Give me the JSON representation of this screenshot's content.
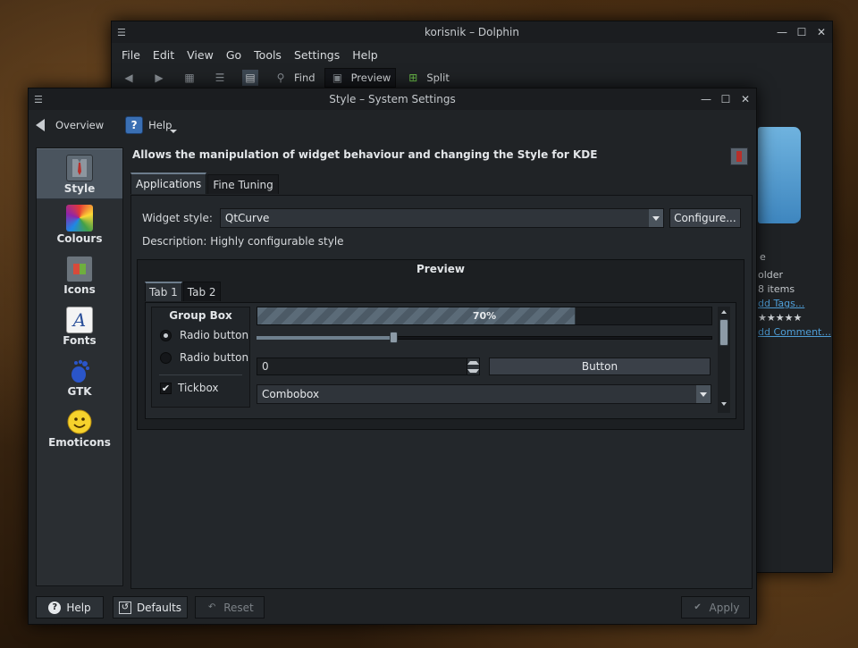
{
  "dolphin": {
    "title": "korisnik – Dolphin",
    "menu": [
      "File",
      "Edit",
      "View",
      "Go",
      "Tools",
      "Settings",
      "Help"
    ],
    "toolbar": {
      "find": "Find",
      "preview": "Preview",
      "split": "Split"
    },
    "info": {
      "line1": "e",
      "line2": "older",
      "line3": "8 items",
      "add_tags": "dd Tags...",
      "stars": "★★★★★",
      "add_comment": "dd Comment..."
    }
  },
  "style_window": {
    "title": "Style – System Settings",
    "toolbar": {
      "overview": "Overview",
      "help": "Help"
    },
    "sidebar": {
      "items": [
        {
          "label": "Style",
          "icon": "style-tie-icon",
          "active": true
        },
        {
          "label": "Colours",
          "icon": "colour-palette-icon",
          "active": false
        },
        {
          "label": "Icons",
          "icon": "icons-cube-icon",
          "active": false
        },
        {
          "label": "Fonts",
          "icon": "font-letter-icon",
          "active": false
        },
        {
          "label": "GTK",
          "icon": "gtk-gnome-foot-icon",
          "active": false
        },
        {
          "label": "Emoticons",
          "icon": "smiley-icon",
          "active": false
        }
      ]
    },
    "heading": "Allows the manipulation of widget behaviour and changing the Style for KDE",
    "tabs": [
      "Applications",
      "Fine Tuning"
    ],
    "widget_style_label": "Widget style:",
    "widget_style_value": "QtCurve",
    "configure_label": "Configure...",
    "description": "Description: Highly configurable style",
    "preview": {
      "title": "Preview",
      "tabs": [
        "Tab 1",
        "Tab 2"
      ],
      "group_box": "Group Box",
      "radio1": "Radio button",
      "radio2": "Radio button",
      "tickbox": "Tickbox",
      "progress_text": "70%",
      "progress_value": 0.7,
      "slider_value": 0.3,
      "spin_value": "0",
      "button_label": "Button",
      "combo_value": "Combobox"
    },
    "buttons": {
      "help": "Help",
      "defaults": "Defaults",
      "reset": "Reset",
      "apply": "Apply"
    }
  },
  "colors": {
    "window_bg": "#202326",
    "titlebar_bg": "#1b1d20",
    "accent_tab": "#6d7d8c",
    "link": "#4f9fd8"
  }
}
